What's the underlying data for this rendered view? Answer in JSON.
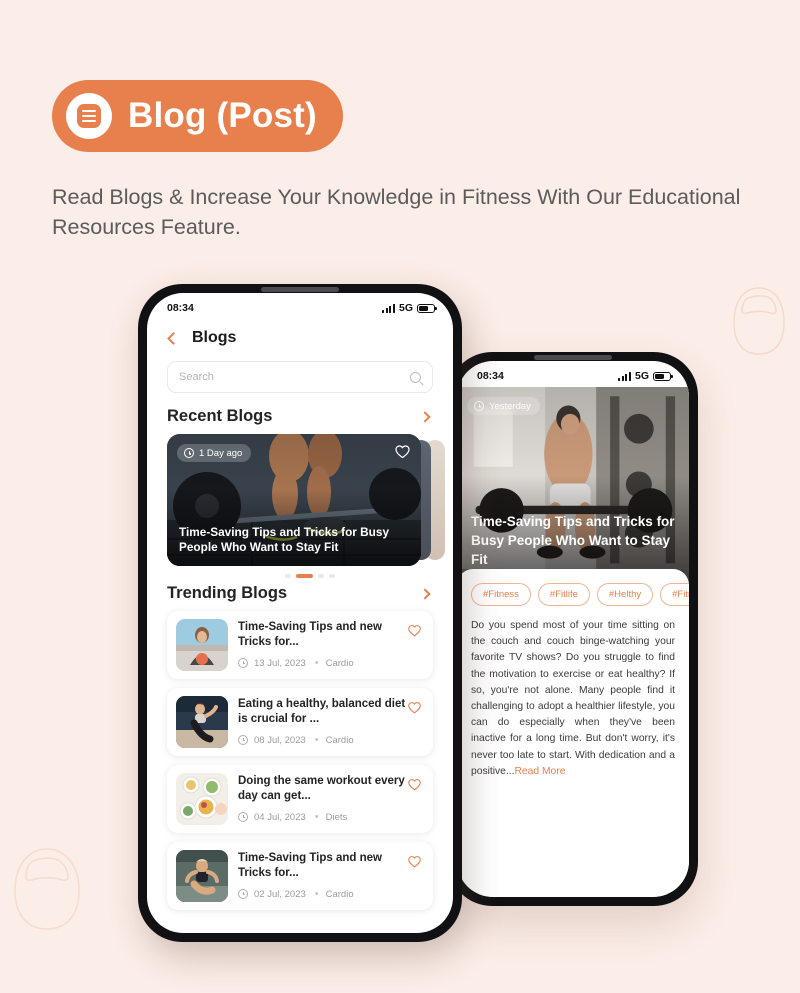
{
  "page": {
    "background_color": "#FBEDE7",
    "accent_color": "#E8804D"
  },
  "header": {
    "badge_label": "Blog (Post)",
    "badge_icon": "document-lines-icon",
    "subtitle": "Read Blogs & Increase Your Knowledge in Fitness With Our Educational Resources Feature."
  },
  "phone_list": {
    "status_bar": {
      "time": "08:34",
      "network": "5G",
      "signal_icon": "signal-bars-icon",
      "battery_icon": "battery-icon"
    },
    "navbar": {
      "back_icon": "chevron-left-icon",
      "title": "Blogs"
    },
    "search": {
      "placeholder": "Search",
      "value": "",
      "icon": "search-icon"
    },
    "recent": {
      "section_title": "Recent Blogs",
      "see_all_icon": "chevron-right-icon",
      "featured": {
        "time_badge": "1 Day ago",
        "time_icon": "clock-icon",
        "favorite_icon": "heart-icon",
        "title": "Time-Saving Tips and Tricks for Busy People Who Want to Stay Fit"
      },
      "pagination": {
        "count": 4,
        "active_index": 1
      }
    },
    "trending": {
      "section_title": "Trending Blogs",
      "see_all_icon": "chevron-right-icon",
      "items": [
        {
          "title": "Time-Saving Tips and new Tricks for...",
          "date": "13 Jul, 2023",
          "category": "Cardio",
          "favorite_icon": "heart-icon",
          "thumb": "woman-outdoor-workout"
        },
        {
          "title": "Eating a healthy, balanced diet is crucial for ...",
          "date": "08 Jul, 2023",
          "category": "Cardio",
          "favorite_icon": "heart-icon",
          "thumb": "woman-stretching-beach"
        },
        {
          "title": "Doing the same workout every day can get...",
          "date": "04 Jul, 2023",
          "category": "Diets",
          "favorite_icon": "heart-icon",
          "thumb": "healthy-food-plates"
        },
        {
          "title": "Time-Saving Tips and new Tricks for...",
          "date": "02 Jul, 2023",
          "category": "Cardio",
          "favorite_icon": "heart-icon",
          "thumb": "woman-gym-pose"
        }
      ]
    }
  },
  "phone_detail": {
    "status_bar": {
      "time": "08:34",
      "network": "5G",
      "signal_icon": "signal-bars-icon",
      "battery_icon": "battery-icon"
    },
    "hero": {
      "time_badge": "Yesterday",
      "time_icon": "clock-icon",
      "title": "Time-Saving Tips and Tricks for Busy People Who Want to Stay Fit"
    },
    "tags": [
      "#Fitness",
      "#Fitlife",
      "#Helthy",
      "#Fitnessfor life"
    ],
    "body": "Do you spend most of your time sitting on the couch and couch binge-watching your favorite TV shows? Do you struggle to find the motivation to exercise or eat healthy? If so, you're not alone. Many people find it challenging to adopt a healthier lifestyle, you can do especially when they've been inactive for a long time. But don't worry, it's never too late to start. With dedication and a positive...",
    "read_more_label": "Read More"
  }
}
